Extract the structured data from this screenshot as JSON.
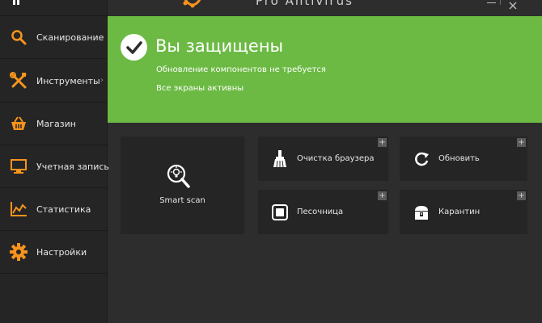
{
  "app": {
    "title": "Pro Antivirus",
    "accent": "#f7941d",
    "status_color": "#6cba44"
  },
  "sidebar": {
    "items": [
      {
        "label": "Сканирование",
        "icon": "magnifier-icon"
      },
      {
        "label": "Инструменты",
        "icon": "tools-icon",
        "chevron": "›"
      },
      {
        "label": "Магазин",
        "icon": "basket-icon"
      },
      {
        "label": "Учетная запись",
        "icon": "monitor-icon"
      },
      {
        "label": "Статистика",
        "icon": "chart-icon"
      },
      {
        "label": "Настройки",
        "icon": "gear-icon"
      }
    ]
  },
  "status": {
    "title": "Вы защищены",
    "line1": "Обновление компонентов не требуется",
    "line2": "Все экраны активны"
  },
  "tiles": {
    "smart_scan": {
      "label": "Smart scan"
    },
    "browser_cleanup": {
      "label": "Очистка браузера"
    },
    "update": {
      "label": "Обновить"
    },
    "sandbox": {
      "label": "Песочница"
    },
    "quarantine": {
      "label": "Карантин"
    },
    "plus": "+"
  }
}
